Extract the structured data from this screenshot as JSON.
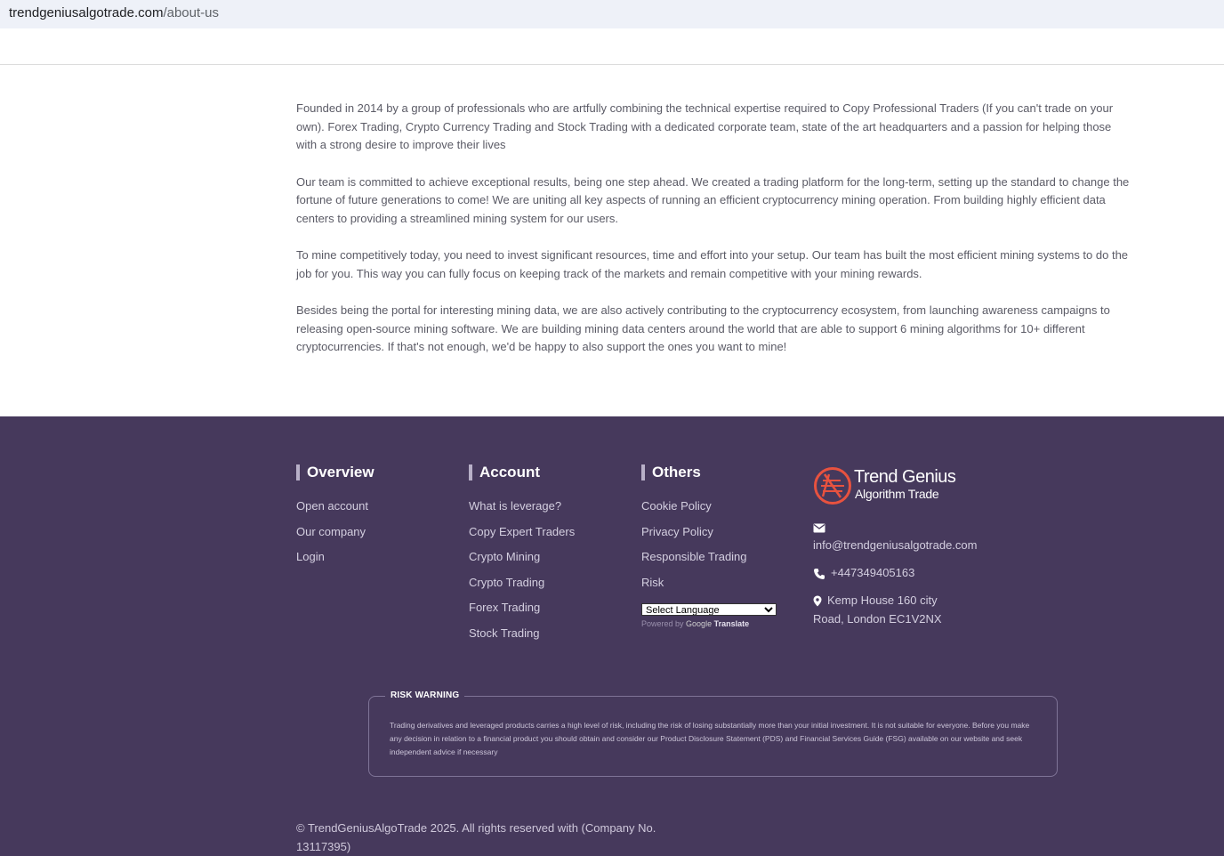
{
  "browser": {
    "url_domain": "trendgeniusalgotrade.com",
    "url_path": "/about-us"
  },
  "about": {
    "paragraphs": [
      "Founded in 2014 by a group of professionals who are artfully combining the technical expertise required to Copy Professional Traders (If you can't trade on your own). Forex Trading, Crypto Currency Trading and Stock Trading with a dedicated corporate team, state of the art headquarters and a passion for helping those with a strong desire to improve their lives",
      "Our team is committed to achieve exceptional results, being one step ahead. We created a trading platform for the long-term, setting up the standard to change the fortune of future generations to come! We are uniting all key aspects of running an efficient cryptocurrency mining operation. From building highly efficient data centers to providing a streamlined mining system for our users.",
      "To mine competitively today, you need to invest significant resources, time and effort into your setup. Our team has built the most efficient mining systems to do the job for you. This way you can fully focus on keeping track of the markets and remain competitive with your mining rewards.",
      "Besides being the portal for interesting mining data, we are also actively contributing to the cryptocurrency ecosystem, from launching awareness campaigns to releasing open-source mining software. We are building mining data centers around the world that are able to support 6 mining algorithms for 10+ different cryptocurrencies. If that's not enough, we'd be happy to also support the ones you want to mine!"
    ]
  },
  "footer": {
    "overview": {
      "heading": "Overview",
      "links": [
        "Open account",
        "Our company",
        "Login"
      ]
    },
    "account": {
      "heading": "Account",
      "links": [
        "What is leverage?",
        "Copy Expert Traders",
        "Crypto Mining",
        "Crypto Trading",
        "Forex Trading",
        "Stock Trading"
      ]
    },
    "others": {
      "heading": "Others",
      "links": [
        "Cookie Policy",
        "Privacy Policy",
        "Responsible Trading",
        "Risk"
      ],
      "language_select": "Select Language",
      "powered_by": "Powered by",
      "google": "Google",
      "translate": "Translate"
    },
    "brand": {
      "line1": "Trend Genius",
      "line2": "Algorithm Trade"
    },
    "contact": {
      "email": "info@trendgeniusalgotrade.com",
      "phone": "+447349405163",
      "address": "Kemp House 160 city Road, London EC1V2NX"
    },
    "risk_warning": {
      "title": "RISK WARNING",
      "body": "Trading derivatives and leveraged products carries a high level of risk, including the risk of losing substantially more than your initial investment. It is not suitable for everyone. Before you make any decision in relation to a financial product you should obtain and consider our Product Disclosure Statement (PDS) and Financial Services Guide (FSG) available on our website and seek independent advice if necessary"
    },
    "copyright": "© TrendGeniusAlgoTrade 2025. All rights reserved with (Company No. 13117395)"
  },
  "colors": {
    "footer_bg": "#46395c",
    "logo_accent": "#e8523f"
  },
  "icons": {
    "email": "envelope-icon",
    "phone": "phone-icon",
    "address": "map-pin-icon",
    "logo": "trend-genius-logo-icon"
  }
}
